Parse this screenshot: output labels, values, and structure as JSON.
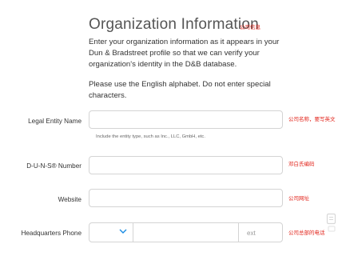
{
  "header": {
    "title": "Organization Information",
    "title_annotation": "公司信息"
  },
  "intro": {
    "paragraph1": "Enter your organization information as it appears in your Dun & Bradstreet profile so that we can verify your organization's identity in the D&B database.",
    "paragraph2": "Please use the English alphabet. Do not enter special characters."
  },
  "form": {
    "legal_entity": {
      "label": "Legal Entity Name",
      "value": "",
      "hint": "Include the entity type, such as Inc., LLC, GmbH, etc.",
      "annotation": "公司名称，要写英文"
    },
    "duns": {
      "label": "D-U-N-S® Number",
      "value": "",
      "annotation": "邓白氏编码"
    },
    "website": {
      "label": "Website",
      "value": "",
      "annotation": "公司网址"
    },
    "phone": {
      "label": "Headquarters Phone",
      "country_code": "",
      "number": "",
      "ext_placeholder": "ext",
      "annotation": "公司总部的电话"
    }
  },
  "colors": {
    "annotation": "#e2231a",
    "chevron": "#1a8ce3",
    "border": "#d4d4d4"
  }
}
